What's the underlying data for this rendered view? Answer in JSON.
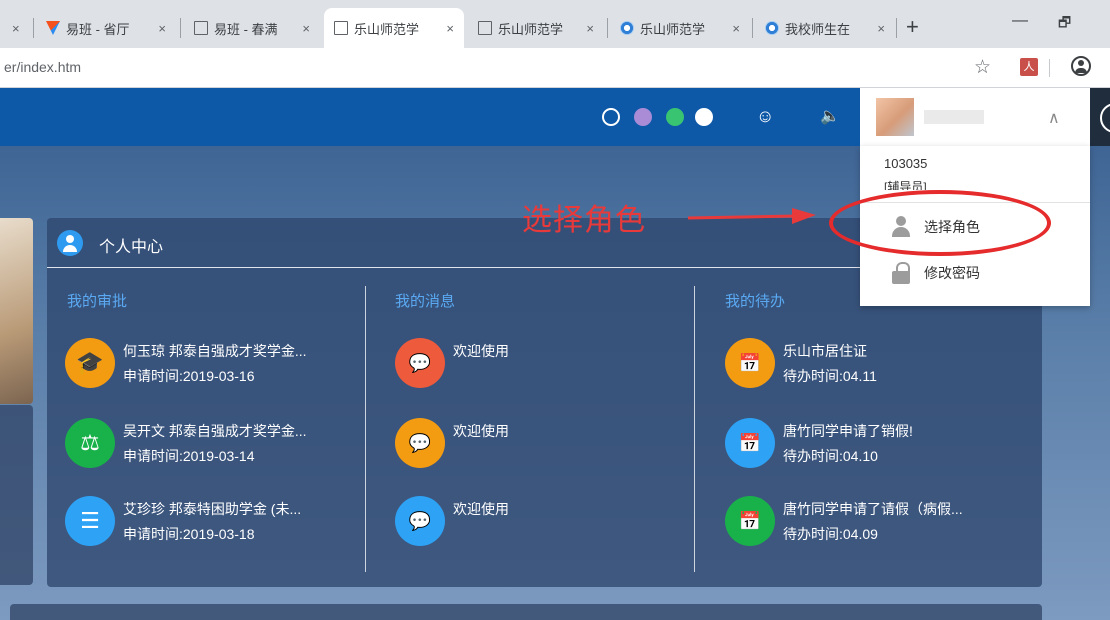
{
  "browser": {
    "tabs": [
      {
        "title": "",
        "close": "×"
      },
      {
        "title": "易班 - 省厅",
        "close": "×"
      },
      {
        "title": "易班 - 春满",
        "close": "×"
      },
      {
        "title": "乐山师范学",
        "close": "×"
      },
      {
        "title": "乐山师范学",
        "close": "×"
      },
      {
        "title": "乐山师范学",
        "close": "×"
      },
      {
        "title": "我校师生在",
        "close": "×"
      }
    ],
    "new_tab": "+",
    "minimize": "—",
    "restore": "🗗",
    "url": "er/index.htm",
    "bookmark_icon": "☆",
    "pdf_icon": "人"
  },
  "topnav": {
    "theme_colors": [
      "#0d59a8",
      "#a98bd6",
      "#39c472",
      "#ffffff"
    ],
    "chat_icon": "☺",
    "volume_icon": "🔈",
    "caret": "∧"
  },
  "card": {
    "title": "个人中心",
    "columns": [
      {
        "title": "我的审批",
        "items": [
          {
            "title": "何玉琼 邦泰自强成才奖学金...",
            "sub": "申请时间:2019-03-16",
            "icon": "🎓",
            "color": "#f39c12"
          },
          {
            "title": "吴开文 邦泰自强成才奖学金...",
            "sub": "申请时间:2019-03-14",
            "icon": "⚖",
            "color": "#19b14a"
          },
          {
            "title": "艾珍珍 邦泰特困助学金 (未...",
            "sub": "申请时间:2019-03-18",
            "icon": "☰",
            "color": "#2ea2f5"
          }
        ]
      },
      {
        "title": "我的消息",
        "items": [
          {
            "title": "欢迎使用",
            "sub": "",
            "icon": "💬",
            "color": "#ee5a3c"
          },
          {
            "title": "欢迎使用",
            "sub": "",
            "icon": "💬",
            "color": "#f39c12"
          },
          {
            "title": "欢迎使用",
            "sub": "",
            "icon": "💬",
            "color": "#2ea2f5"
          }
        ]
      },
      {
        "title": "我的待办",
        "items": [
          {
            "title": "乐山市居住证",
            "sub": "待办时间:04.11",
            "icon": "📅",
            "color": "#f39c12"
          },
          {
            "title": "唐竹同学申请了销假!",
            "sub": "待办时间:04.10",
            "icon": "📅",
            "color": "#2ea2f5"
          },
          {
            "title": "唐竹同学申请了请假（病假...",
            "sub": "待办时间:04.09",
            "icon": "📅",
            "color": "#19b14a"
          }
        ]
      }
    ]
  },
  "dropdown": {
    "user_id": "103035",
    "role": "[辅导员]",
    "items": [
      {
        "label": "选择角色",
        "icon": "person-icon"
      },
      {
        "label": "修改密码",
        "icon": "lock-icon"
      }
    ]
  },
  "annotation": {
    "text": "选择角色",
    "color": "#e52b2b"
  }
}
